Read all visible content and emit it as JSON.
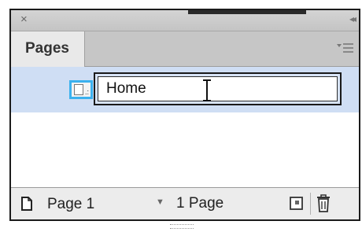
{
  "window": {
    "close_glyph": "×",
    "collapse_glyph": "◂◂"
  },
  "tabs": [
    {
      "label": "Pages",
      "active": true
    }
  ],
  "pages": [
    {
      "name": "Home",
      "editing": true
    }
  ],
  "footer": {
    "current_page": "Page 1",
    "page_count": "1 Page"
  },
  "icons": {
    "close": "close-icon",
    "collapse": "collapse-panel-icon",
    "menu": "panel-menu-icon",
    "page": "page-icon",
    "new_page": "new-page-icon",
    "delete": "trash-icon",
    "cursor": "text-cursor-icon"
  },
  "colors": {
    "selection_row": "#cfdef4",
    "thumb_highlight": "#3bb1ee",
    "panel_bg": "#ececec",
    "tab_bg": "#e9e9e9",
    "tab_row_bg": "#c6c6c6"
  }
}
